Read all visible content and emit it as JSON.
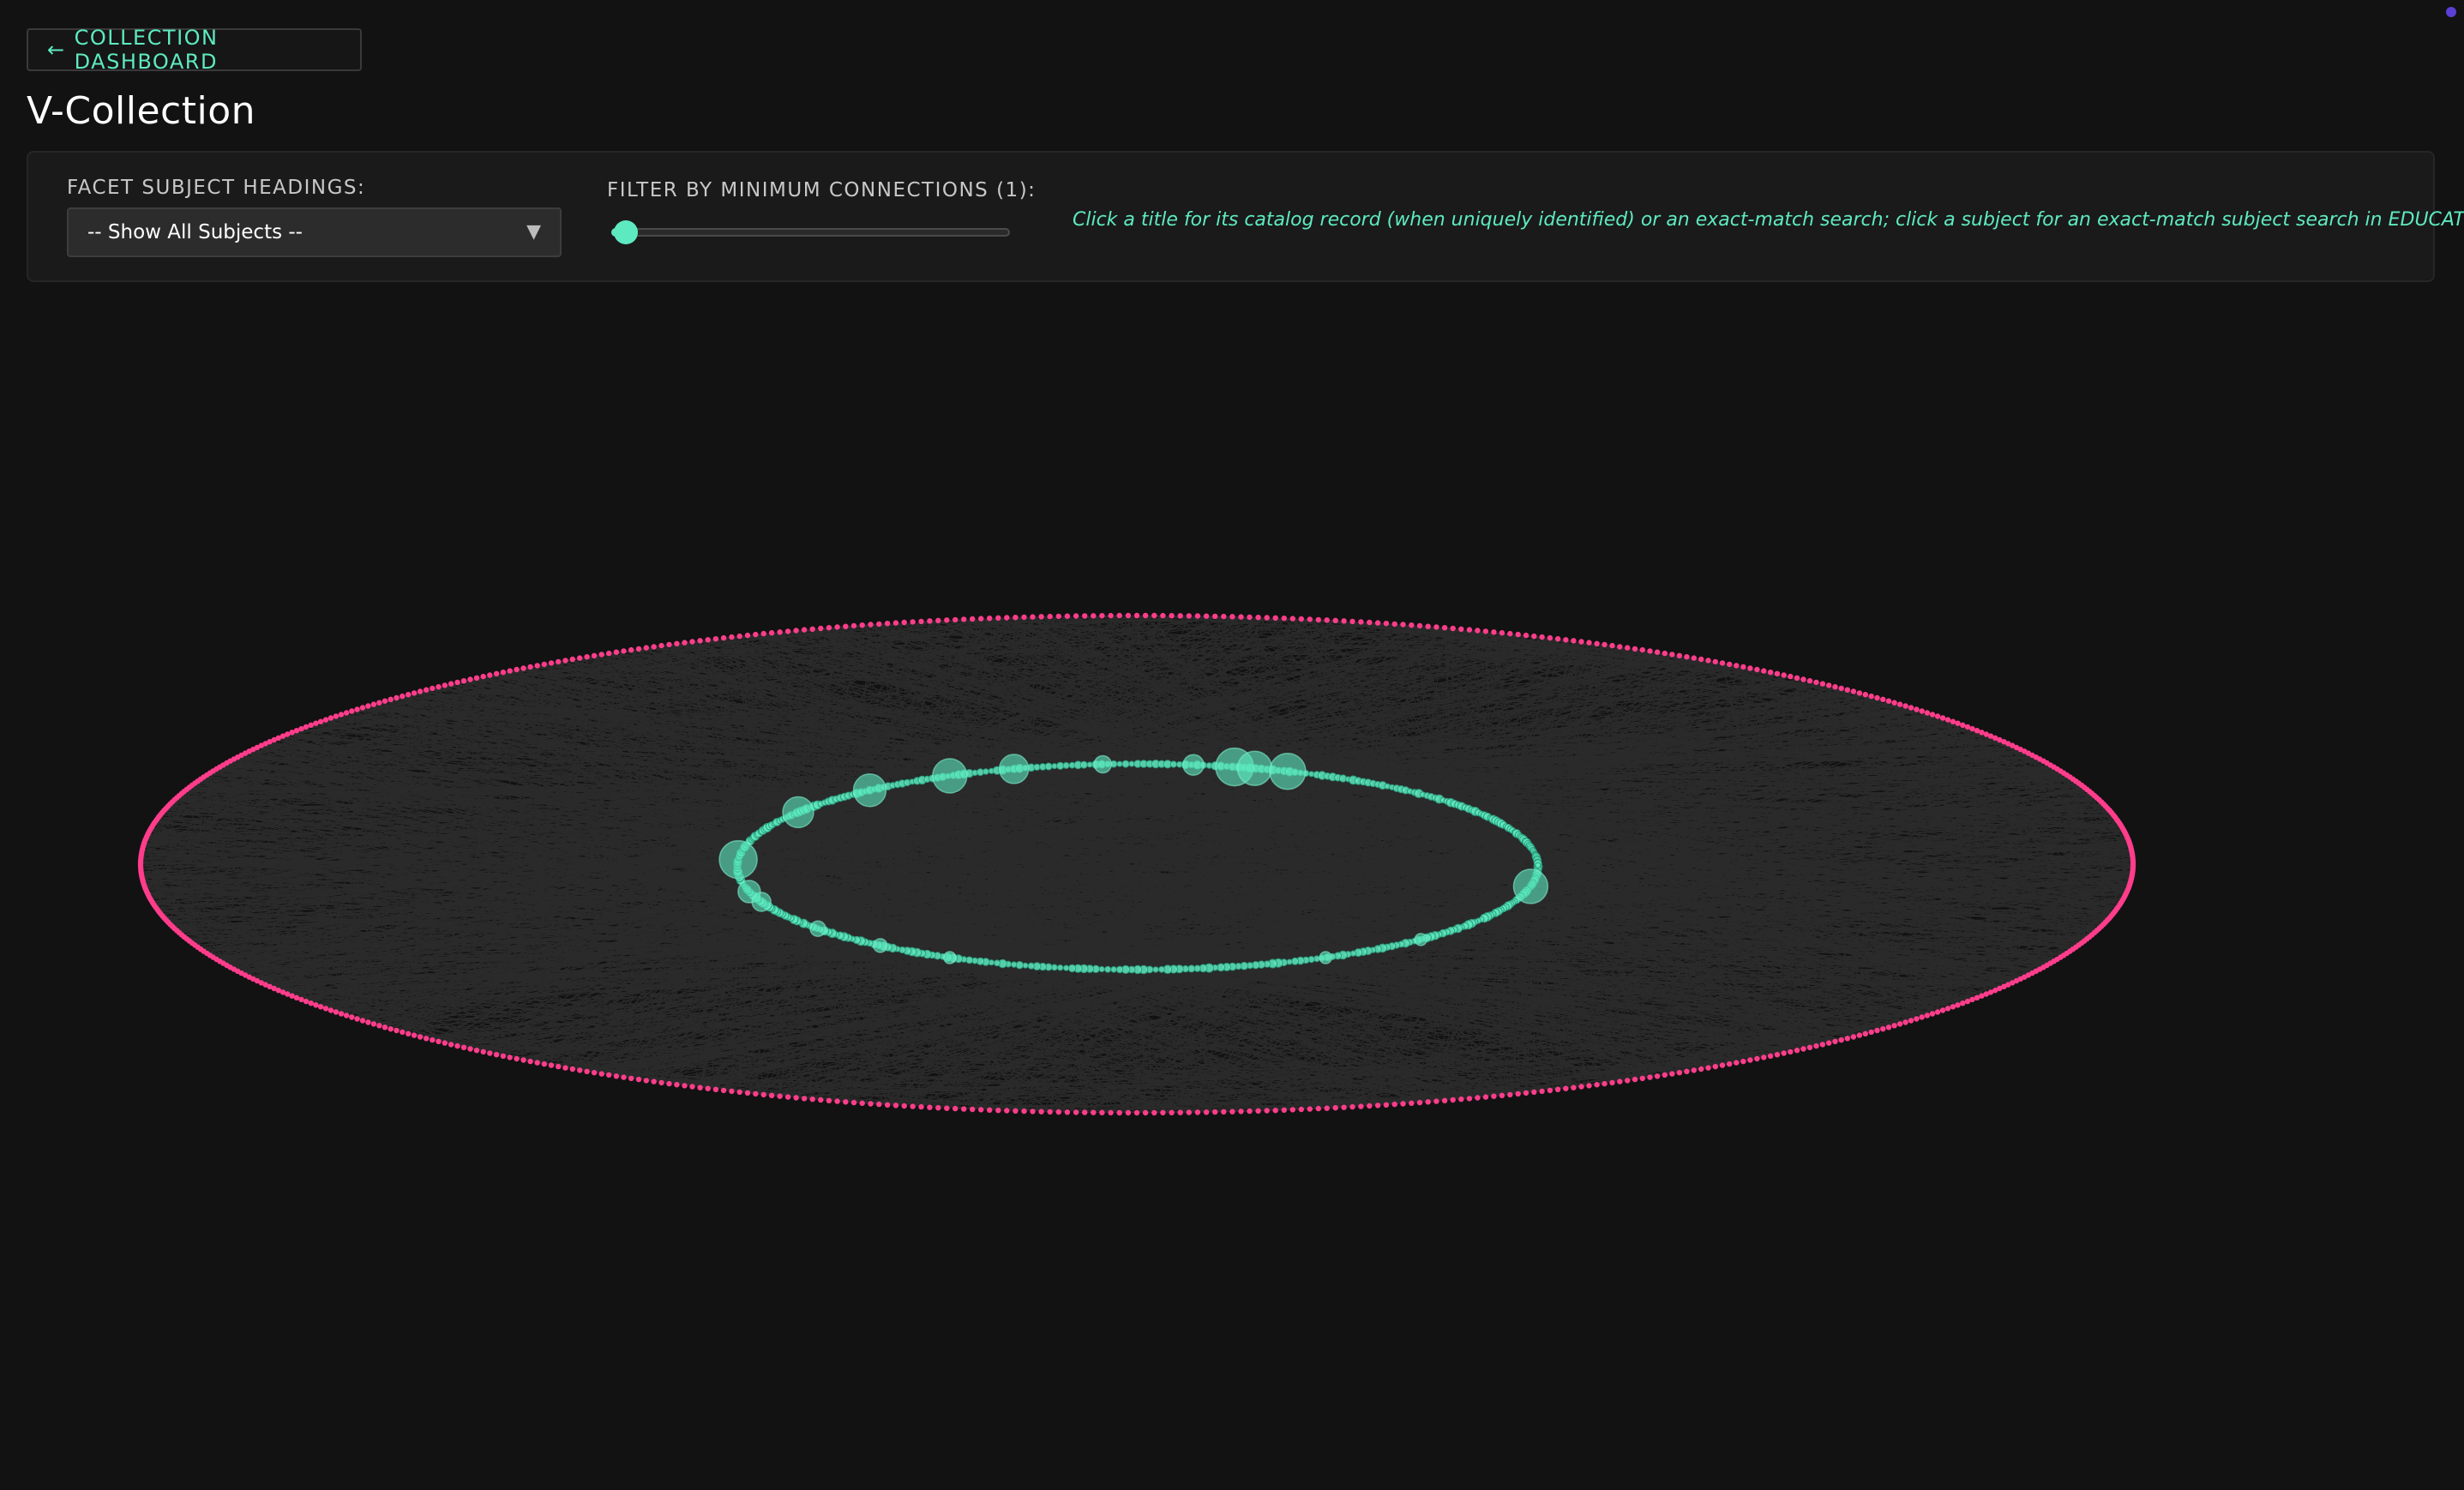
{
  "header": {
    "back_arrow": "←",
    "back_label": "COLLECTION DASHBOARD",
    "title": "V-Collection"
  },
  "controls": {
    "facet_label": "FACET SUBJECT HEADINGS:",
    "facet_selected": "-- Show All Subjects --",
    "filter_label": "FILTER BY MINIMUM CONNECTIONS (1):",
    "min_connections": 1,
    "instructions": "Click a title for its catalog record (when uniquely identified) or an exact-match search; click a subject for an exact-match subject search in EDUCAT+."
  },
  "colors": {
    "background": "#121212",
    "accent": "#5eeac0",
    "subject_ring": "#ff3d8b",
    "edge": "#4a4a4a",
    "status_dot": "#5b3fd6"
  },
  "icons": {
    "back": "arrow-left-icon",
    "select": "caret-down-icon"
  }
}
